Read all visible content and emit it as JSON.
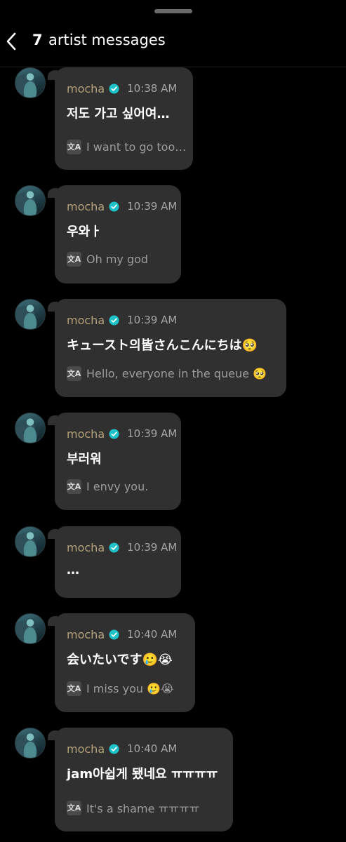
{
  "header": {
    "count": "7",
    "title": "artist messages"
  },
  "translate_icon_glyph": "文A",
  "icons": {
    "back": "chevron-left-icon",
    "verified": "verified-badge-icon",
    "translate": "translate-icon"
  },
  "colors": {
    "background": "#000000",
    "bubble": "#303030",
    "sender": "#b5a27a",
    "verified": "#1fc1c8",
    "time": "#a5a5a5",
    "translation": "#9c9c9c"
  },
  "messages": [
    {
      "sender": "mocha",
      "time": "10:38 AM",
      "text": "저도 가고 싶어여…",
      "translation": "I want to go too…"
    },
    {
      "sender": "mocha",
      "time": "10:39 AM",
      "text": "우와ㅏ",
      "translation": "Oh my god"
    },
    {
      "sender": "mocha",
      "time": "10:39 AM",
      "text": "キュースト의皆さんこんにちは🥺",
      "translation": "Hello, everyone in the queue 🥺"
    },
    {
      "sender": "mocha",
      "time": "10:39 AM",
      "text": "부러워",
      "translation": "I envy you."
    },
    {
      "sender": "mocha",
      "time": "10:39 AM",
      "text": "…",
      "translation": ""
    },
    {
      "sender": "mocha",
      "time": "10:40 AM",
      "text": "会いたいです🥲😭",
      "translation": "I miss you 🥲😭"
    },
    {
      "sender": "mocha",
      "time": "10:40 AM",
      "text": "jam아쉽게 됐네요 ㅠㅠㅠㅠ",
      "translation": "It's a shame ㅠㅠㅠㅠ"
    }
  ]
}
